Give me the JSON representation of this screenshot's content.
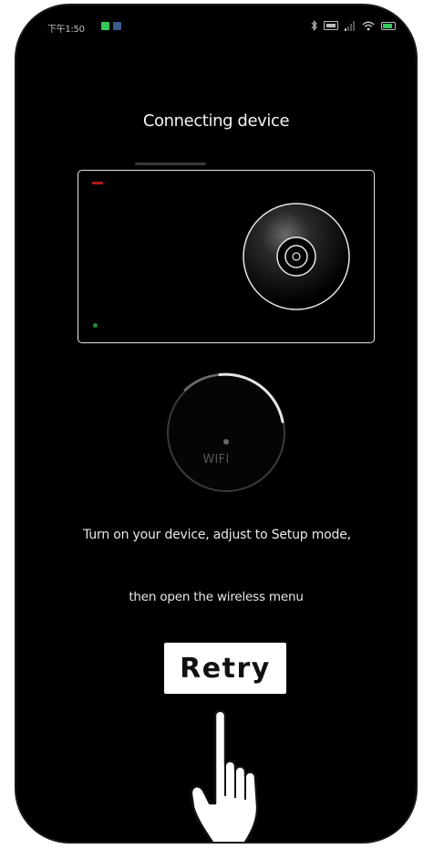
{
  "status_bar": {
    "time": "下午1:50",
    "icons": [
      "notification-green-icon",
      "notification-image-icon",
      "bluetooth-icon",
      "sim-icon",
      "signal-icon",
      "wifi-icon",
      "battery-icon"
    ]
  },
  "screen": {
    "title": "Connecting device",
    "device_illustration": {
      "indicator_light_top": "red",
      "indicator_light_bottom": "green",
      "dial_icon": "disc-knob-icon"
    },
    "wifi_dial": {
      "label": "WIFI",
      "icon": "wifi-dial-icon"
    },
    "instruction_line1": "Turn on your device, adjust to Setup mode,",
    "instruction_line2": "then open the wireless menu",
    "retry_label": "Retry",
    "pointer_icon": "hand-pointer-icon"
  },
  "colors": {
    "background": "#000000",
    "text": "#e8e8e8",
    "led_red": "#b3171b",
    "led_green": "#1f8a3b",
    "battery": "#34c759",
    "button_bg": "#ffffff"
  }
}
